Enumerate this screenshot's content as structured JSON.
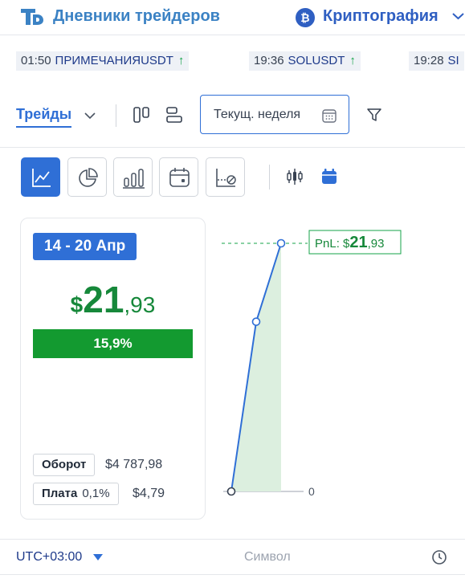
{
  "header": {
    "brand_name": "Дневники трейдеров",
    "category_label": "Криптография",
    "category_icon": "bitcoin-icon"
  },
  "ticker": [
    {
      "time": "01:50",
      "symbol": "ПРИМЕЧАНИЯUSDT",
      "direction": "up"
    },
    {
      "time": "19:36",
      "symbol": "SOLUSDT",
      "direction": "up"
    },
    {
      "time": "19:28",
      "symbol": "SI",
      "direction": "up"
    }
  ],
  "toolbar": {
    "trades_label": "Трейды",
    "date_range_label": "Текущ. неделя"
  },
  "chart_types": {
    "active": "line-chart-icon",
    "items": [
      "line-chart-icon",
      "pie-chart-icon",
      "bar-chart-icon",
      "calendar-chart-icon",
      "trend-stop-icon"
    ]
  },
  "summary": {
    "range_label": "14 - 20 Апр",
    "pnl_currency": "$",
    "pnl_integer": "21",
    "pnl_decimal": ",93",
    "pnl_percent": "15,9%",
    "turnover_label": "Оборот",
    "turnover_value": "$4 787,98",
    "fee_label": "Плата",
    "fee_percent": "0,1%",
    "fee_value": "$4,79"
  },
  "chart_data": {
    "type": "area",
    "x": [
      0,
      1,
      2
    ],
    "y": [
      0,
      15.0,
      21.93
    ],
    "zero_label": "0",
    "pnl_label_prefix": "PnL: $",
    "pnl_label_integer": "21",
    "pnl_label_decimal": ",93",
    "ylim": [
      0,
      21.93
    ]
  },
  "footer": {
    "timezone": "UTC+03:00",
    "symbol_label": "Символ"
  },
  "colors": {
    "accent": "#2f6fd6",
    "profit": "#16883a",
    "profit_bar": "#139a30",
    "brand": "#3b82c4"
  }
}
